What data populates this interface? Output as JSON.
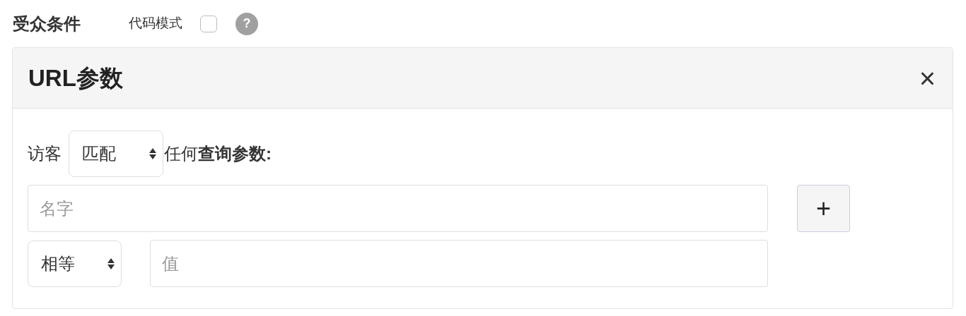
{
  "section": {
    "title": "受众条件",
    "code_mode": {
      "label": "代码模式",
      "checked": false
    },
    "help": "?"
  },
  "panel": {
    "title": "URL参数",
    "close": "×",
    "rule": {
      "prefix": "访客",
      "match_select": {
        "value": "匹配"
      },
      "suffix": "任何**查询参数:**"
    },
    "name_field": {
      "placeholder": "名字"
    },
    "add_button": "+",
    "operator_select": {
      "value": "相等"
    },
    "value_field": {
      "placeholder": "值"
    }
  }
}
